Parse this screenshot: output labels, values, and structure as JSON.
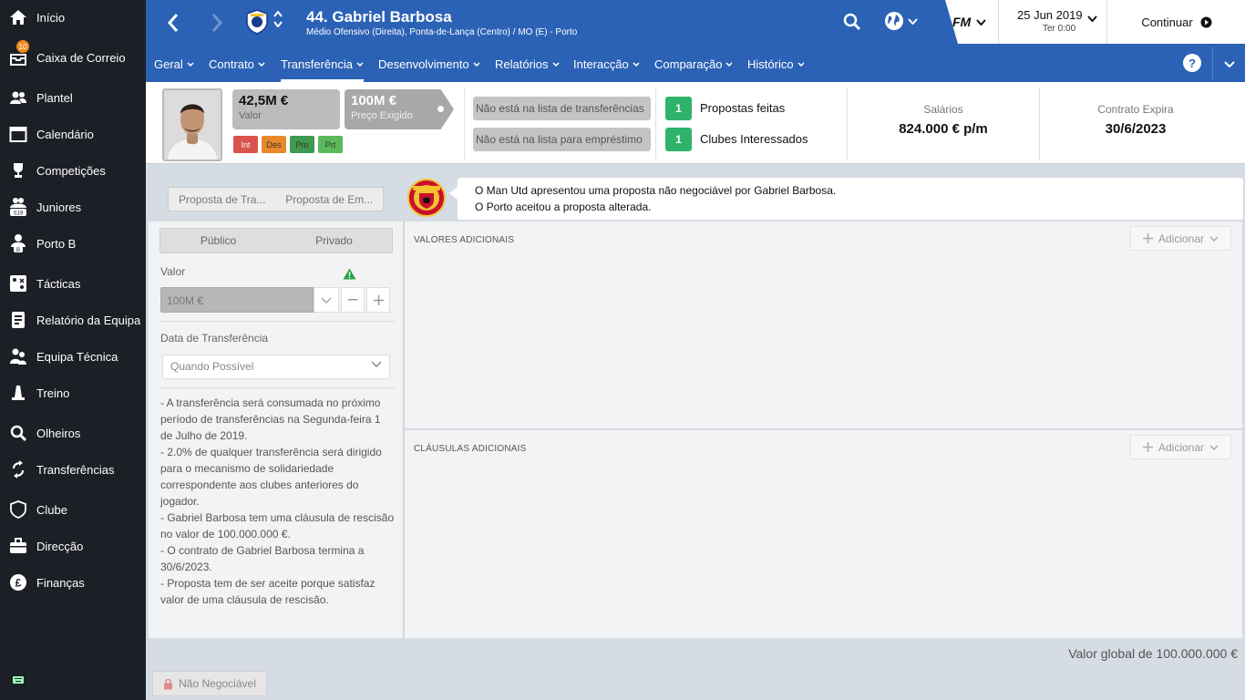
{
  "sidebar": {
    "items": [
      {
        "label": "Início",
        "icon": "home-icon"
      },
      {
        "label": "Caixa de Correio",
        "icon": "inbox-icon",
        "badge": "10"
      },
      {
        "label": "Plantel",
        "icon": "squad-icon"
      },
      {
        "label": "Calendário",
        "icon": "calendar-icon"
      },
      {
        "label": "Competições",
        "icon": "trophy-icon"
      },
      {
        "label": "Juniores",
        "icon": "juniors-icon",
        "badge_text": "S19"
      },
      {
        "label": "Porto B",
        "icon": "reserve-team-icon",
        "badge_text": "B"
      },
      {
        "label": "Tácticas",
        "icon": "tactics-icon"
      },
      {
        "label": "Relatório da Equipa",
        "icon": "team-report-icon"
      },
      {
        "label": "Equipa Técnica",
        "icon": "staff-icon"
      },
      {
        "label": "Treino",
        "icon": "training-icon"
      },
      {
        "label": "Olheiros",
        "icon": "scouting-icon"
      },
      {
        "label": "Transferências",
        "icon": "transfers-icon"
      },
      {
        "label": "Clube",
        "icon": "club-icon"
      },
      {
        "label": "Direcção",
        "icon": "board-icon"
      },
      {
        "label": "Finanças",
        "icon": "finances-icon"
      }
    ]
  },
  "header": {
    "player_name": "44. Gabriel Barbosa",
    "player_sub": "Médio Ofensivo (Direita), Ponta-de-Lança (Centro) / MO (E) - Porto",
    "fm_logo": "FM",
    "date": "25 Jun 2019",
    "time": "Ter 0:00",
    "continue_label": "Continuar",
    "accent_color": "#2b62b5",
    "tabs": [
      {
        "label": "Geral"
      },
      {
        "label": "Contrato"
      },
      {
        "label": "Transferência",
        "active": true
      },
      {
        "label": "Desenvolvimento"
      },
      {
        "label": "Relatórios"
      },
      {
        "label": "Interacção"
      },
      {
        "label": "Comparação"
      },
      {
        "label": "Histórico"
      }
    ],
    "help_label": "?"
  },
  "info": {
    "value": "42,5M €",
    "value_label": "Valor",
    "asking_price": "100M €",
    "asking_label": "Preço Exigido",
    "attributes": [
      {
        "label": "Int",
        "color": "#d9534f"
      },
      {
        "label": "Des",
        "color": "#e8892b"
      },
      {
        "label": "Pro",
        "color": "#3f9a4f"
      },
      {
        "label": "Prt",
        "color": "#5cb85c"
      }
    ],
    "transfer_list_status": "Não está na lista de transferências",
    "loan_list_status": "Não está na lista para empréstimo",
    "offers_made_count": "1",
    "offers_made_label": "Propostas feitas",
    "interested_count": "1",
    "interested_label": "Clubes Interessados",
    "wages_label": "Salários",
    "wages_value": "824.000 € p/m",
    "contract_label": "Contrato Expira",
    "contract_value": "30/6/2023"
  },
  "offer": {
    "tab_transfer": "Proposta de Tra...",
    "tab_loan": "Proposta de Em...",
    "message_line1": "O Man Utd apresentou uma proposta não negociável por Gabriel Barbosa.",
    "message_line2": "O Porto aceitou a proposta alterada."
  },
  "form": {
    "public_label": "Público",
    "private_label": "Privado",
    "value_label": "Valor",
    "value_input": "100M €",
    "date_label": "Data de Transferência",
    "date_value": "Quando Possível",
    "notes": [
      "- A transferência será consumada no próximo período de transferências na Segunda-feira 1 de Julho de 2019.",
      "- 2.0% de qualquer transferência será dirigido para o mecanismo de solidariedade correspondente aos clubes anteriores do jogador.",
      "- Gabriel Barbosa tem uma cláusula de rescisão no valor de 100.000.000 €.",
      "- O contrato de Gabriel Barbosa termina a 30/6/2023.",
      "- Proposta tem de ser aceite porque satisfaz valor de uma cláusula de rescisão."
    ]
  },
  "sections": {
    "extra_values_title": "VALORES ADICIONAIS",
    "extra_clauses_title": "CLÁUSULAS ADICIONAIS",
    "add_label": "Adicionar"
  },
  "footer": {
    "global_value": "Valor global de 100.000.000 €",
    "non_negotiable": "Não Negociável"
  }
}
